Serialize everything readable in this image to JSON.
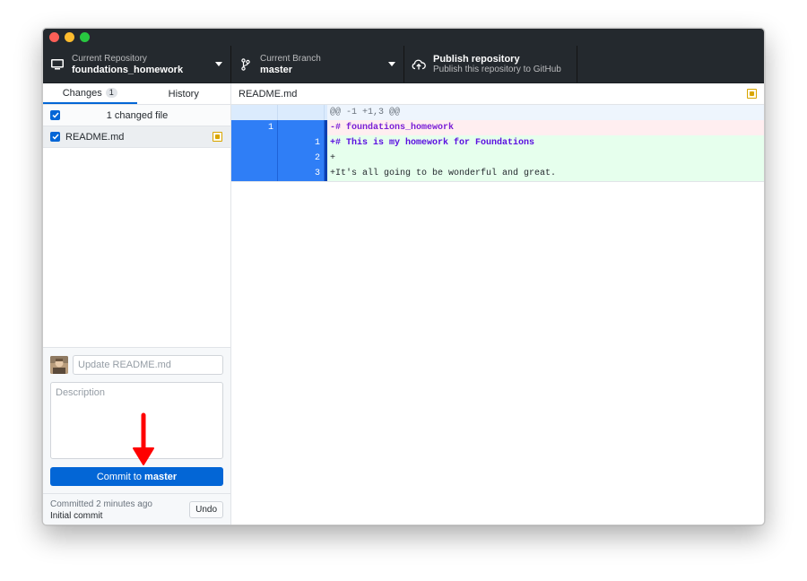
{
  "toolbar": {
    "repo": {
      "sub": "Current Repository",
      "main": "foundations_homework"
    },
    "branch": {
      "sub": "Current Branch",
      "main": "master"
    },
    "publish": {
      "main": "Publish repository",
      "sub": "Publish this repository to GitHub"
    }
  },
  "sidebar": {
    "tabs": [
      {
        "label": "Changes",
        "count": "1"
      },
      {
        "label": "History"
      }
    ],
    "changed_header": "1 changed file",
    "files": [
      {
        "name": "README.md",
        "status": "modified"
      }
    ]
  },
  "commit": {
    "summary_placeholder": "Update README.md",
    "description_placeholder": "Description",
    "button_prefix": "Commit to ",
    "button_branch": "master"
  },
  "last_commit": {
    "time": "Committed 2 minutes ago",
    "message": "Initial commit",
    "undo_label": "Undo"
  },
  "diff": {
    "file": "README.md",
    "lines": [
      {
        "type": "hunk",
        "old": "",
        "new": "",
        "text": "@@ -1 +1,3 @@"
      },
      {
        "type": "del",
        "old": "1",
        "new": "",
        "text": "-# foundations_homework"
      },
      {
        "type": "add",
        "old": "",
        "new": "1",
        "text": "+# This is my homework for Foundations"
      },
      {
        "type": "add",
        "old": "",
        "new": "2",
        "text": "+"
      },
      {
        "type": "add",
        "old": "",
        "new": "3",
        "text": "+It's all going to be wonderful and great."
      }
    ]
  },
  "colors": {
    "accent": "#0366d6",
    "toolbar_bg": "#24292e",
    "annotation_arrow": "#ff0000"
  }
}
